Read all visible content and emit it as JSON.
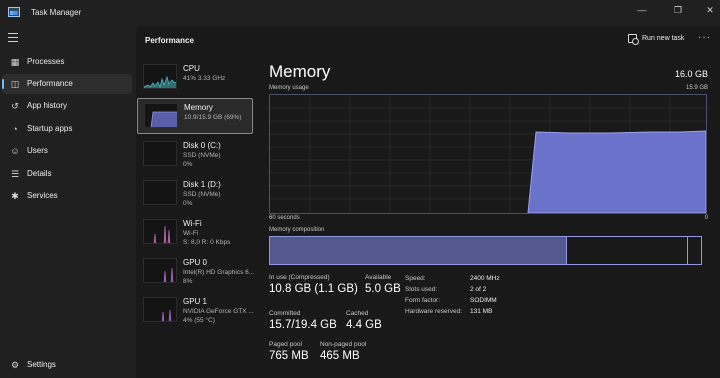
{
  "window": {
    "title": "Task Manager",
    "minimize_glyph": "—",
    "maximize_glyph": "❐",
    "close_glyph": "✕"
  },
  "sidebar": {
    "items": [
      {
        "label": "Processes",
        "icon": "grid-icon",
        "glyph": "▦"
      },
      {
        "label": "Performance",
        "icon": "pulse-icon",
        "glyph": "◫"
      },
      {
        "label": "App history",
        "icon": "history-icon",
        "glyph": "↺"
      },
      {
        "label": "Startup apps",
        "icon": "speedometer-icon",
        "glyph": "◔"
      },
      {
        "label": "Users",
        "icon": "users-icon",
        "glyph": "☺"
      },
      {
        "label": "Details",
        "icon": "list-icon",
        "glyph": "☰"
      },
      {
        "label": "Services",
        "icon": "puzzle-icon",
        "glyph": "✱"
      }
    ],
    "settings": {
      "label": "Settings",
      "icon": "gear-icon",
      "glyph": "⚙"
    }
  },
  "header": {
    "section_title": "Performance",
    "run_new_task": "Run new task",
    "more": "···"
  },
  "devices": [
    {
      "name": "CPU",
      "sub1": "41%  3.33 GHz",
      "sub2": "",
      "color": "#4fb7c2"
    },
    {
      "name": "Memory",
      "sub1": "10.9/15.9 GB (69%)",
      "sub2": "",
      "color": "#6b72c9"
    },
    {
      "name": "Disk 0 (C:)",
      "sub1": "SSD (NVMe)",
      "sub2": "0%",
      "color": "#5fa34f"
    },
    {
      "name": "Disk 1 (D:)",
      "sub1": "SSD (NVMe)",
      "sub2": "0%",
      "color": "#5fa34f"
    },
    {
      "name": "Wi-Fi",
      "sub1": "Wi-Fi",
      "sub2": "S: 8.0  R: 0 Kbps",
      "color": "#c46fbe"
    },
    {
      "name": "GPU 0",
      "sub1": "Intel(R) HD Graphics 6...",
      "sub2": "8%",
      "color": "#b06fc9"
    },
    {
      "name": "GPU 1",
      "sub1": "NVIDIA GeForce GTX ...",
      "sub2": "4%  (55 °C)",
      "color": "#b06fc9"
    }
  ],
  "memory": {
    "title": "Memory",
    "total": "16.0 GB",
    "usage_label": "Memory usage",
    "usage_max": "15.9 GB",
    "axis_left": "60 seconds",
    "axis_right": "0",
    "composition_label": "Memory composition",
    "in_use_fraction": 0.69,
    "cached_fraction": 0.28,
    "graph_color": "#6b72c9",
    "stats": {
      "in_use_label": "In use (Compressed)",
      "in_use_value": "10.8 GB (1.1 GB)",
      "available_label": "Available",
      "available_value": "5.0 GB",
      "committed_label": "Committed",
      "committed_value": "15.7/19.4 GB",
      "cached_label": "Cached",
      "cached_value": "4.4 GB",
      "paged_label": "Paged pool",
      "paged_value": "765 MB",
      "nonpaged_label": "Non-paged pool",
      "nonpaged_value": "465 MB"
    },
    "specs": [
      {
        "key": "Speed:",
        "value": "2400 MHz"
      },
      {
        "key": "Slots used:",
        "value": "2 of 2"
      },
      {
        "key": "Form factor:",
        "value": "SODIMM"
      },
      {
        "key": "Hardware reserved:",
        "value": "131 MB"
      }
    ]
  }
}
